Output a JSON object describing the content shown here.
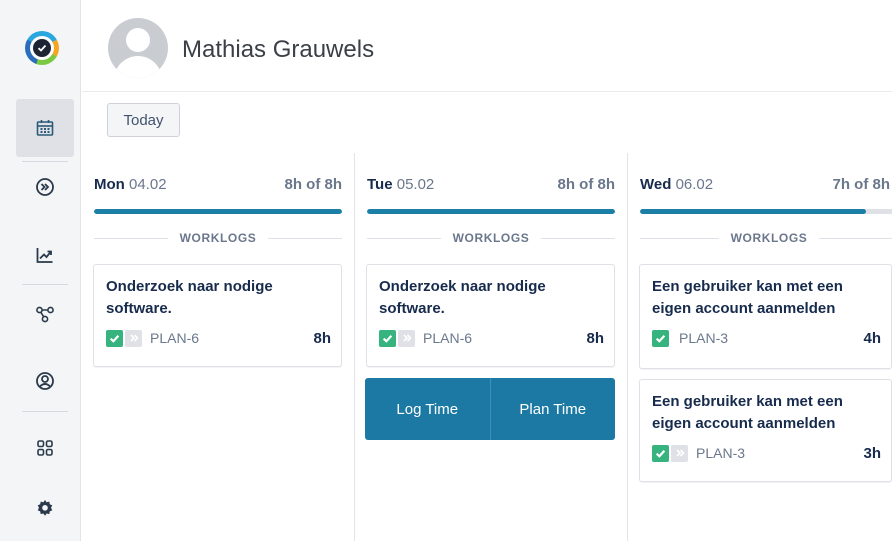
{
  "user": {
    "name": "Mathias Grauwels"
  },
  "toolbar": {
    "today_label": "Today"
  },
  "colors": {
    "accent": "#1c79a3",
    "progress": "#1b7fa6",
    "check": "#36b37e"
  },
  "sidebar": {
    "items": [
      {
        "icon": "calendar-icon",
        "active": true
      },
      {
        "icon": "forward-circle-icon",
        "active": false
      },
      {
        "icon": "chart-icon",
        "active": false
      },
      {
        "icon": "workflow-icon",
        "active": false
      },
      {
        "icon": "user-circle-icon",
        "active": false
      },
      {
        "icon": "grid-icon",
        "active": false
      },
      {
        "icon": "gear-icon",
        "active": false
      }
    ]
  },
  "section_label": "WORKLOGS",
  "days": [
    {
      "name": "Mon",
      "date": "04.02",
      "hours": "8h of 8h",
      "progress": 1.0,
      "cards": [
        {
          "title": "Onderzoek naar nodige software.",
          "key": "PLAN-6",
          "hours": "8h",
          "chevron": true
        }
      ]
    },
    {
      "name": "Tue",
      "date": "05.02",
      "hours": "8h of 8h",
      "progress": 1.0,
      "cards": [
        {
          "title": "Onderzoek naar nodige software.",
          "key": "PLAN-6",
          "hours": "8h",
          "chevron": true
        }
      ],
      "actions": {
        "log_time": "Log Time",
        "plan_time": "Plan Time"
      }
    },
    {
      "name": "Wed",
      "date": "06.02",
      "hours": "7h of 8h",
      "progress": 0.875,
      "cards": [
        {
          "title": "Een gebruiker kan met een eigen account aanmelden",
          "key": "PLAN-3",
          "hours": "4h",
          "chevron": false
        },
        {
          "title": "Een gebruiker kan met een eigen account aanmelden",
          "key": "PLAN-3",
          "hours": "3h",
          "chevron": true
        }
      ]
    }
  ]
}
